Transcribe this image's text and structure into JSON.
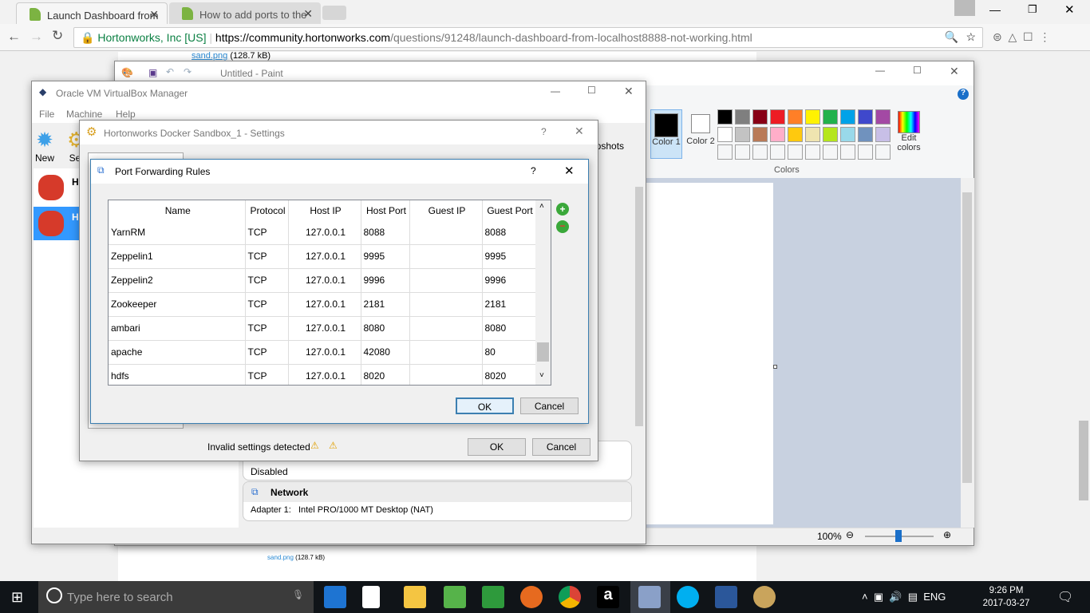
{
  "browser": {
    "tabs": [
      {
        "title": "Launch Dashboard from"
      },
      {
        "title": "How to add ports to the"
      }
    ],
    "site_identity": "Hortonworks, Inc [US]",
    "url_host": "https://community.hortonworks.com",
    "url_path": "/questions/91248/launch-dashboard-from-localhost8888-not-working.html",
    "attachment_name": "sand.png",
    "attachment_size": "(128.7 kB)"
  },
  "paint": {
    "title": "Untitled - Paint",
    "color1": "Color 1",
    "color2": "Color 2",
    "edit_colors": "Edit colors",
    "colors_group": "Colors",
    "zoom": "100%",
    "palette_row1": [
      "#000000",
      "#7f7f7f",
      "#880015",
      "#ed1c24",
      "#ff7f27",
      "#fff200",
      "#22b14c",
      "#00a2e8",
      "#3f48cc",
      "#a349a4"
    ],
    "palette_row2": [
      "#ffffff",
      "#c3c3c3",
      "#b97a57",
      "#ffaec9",
      "#ffc90e",
      "#efe4b0",
      "#b5e61d",
      "#99d9ea",
      "#7092be",
      "#c8bfe7"
    ]
  },
  "vbox": {
    "title": "Oracle VM VirtualBox Manager",
    "menu": [
      "File",
      "Machine",
      "Help"
    ],
    "tool_new": "New",
    "tool_settings": "Set",
    "vm1_short": "Ho",
    "vm2_short": "Ho",
    "snapshots": "apshots",
    "details": {
      "disabled": "Disabled",
      "network_header": "Network",
      "adapter_label": "Adapter 1:",
      "adapter_value": "Intel PRO/1000 MT Desktop (NAT)"
    }
  },
  "settings": {
    "title": "Hortonworks Docker Sandbox_1 - Settings",
    "help": "?",
    "invalid": "Invalid settings detected",
    "ok": "OK",
    "cancel": "Cancel"
  },
  "pf": {
    "title": "Port Forwarding Rules",
    "help": "?",
    "ok": "OK",
    "cancel": "Cancel",
    "columns": [
      "Name",
      "Protocol",
      "Host IP",
      "Host Port",
      "Guest IP",
      "Guest Port"
    ],
    "rows": [
      [
        "YarnRM",
        "TCP",
        "127.0.0.1",
        "8088",
        "",
        "8088"
      ],
      [
        "Zeppelin1",
        "TCP",
        "127.0.0.1",
        "9995",
        "",
        "9995"
      ],
      [
        "Zeppelin2",
        "TCP",
        "127.0.0.1",
        "9996",
        "",
        "9996"
      ],
      [
        "Zookeeper",
        "TCP",
        "127.0.0.1",
        "2181",
        "",
        "2181"
      ],
      [
        "ambari",
        "TCP",
        "127.0.0.1",
        "8080",
        "",
        "8080"
      ],
      [
        "apache",
        "TCP",
        "127.0.0.1",
        "42080",
        "",
        "80"
      ],
      [
        "hdfs",
        "TCP",
        "127.0.0.1",
        "8020",
        "",
        "8020"
      ]
    ]
  },
  "taskbar": {
    "search_placeholder": "Type here to search",
    "lang": "ENG",
    "time": "9:26 PM",
    "date": "2017-03-27"
  }
}
